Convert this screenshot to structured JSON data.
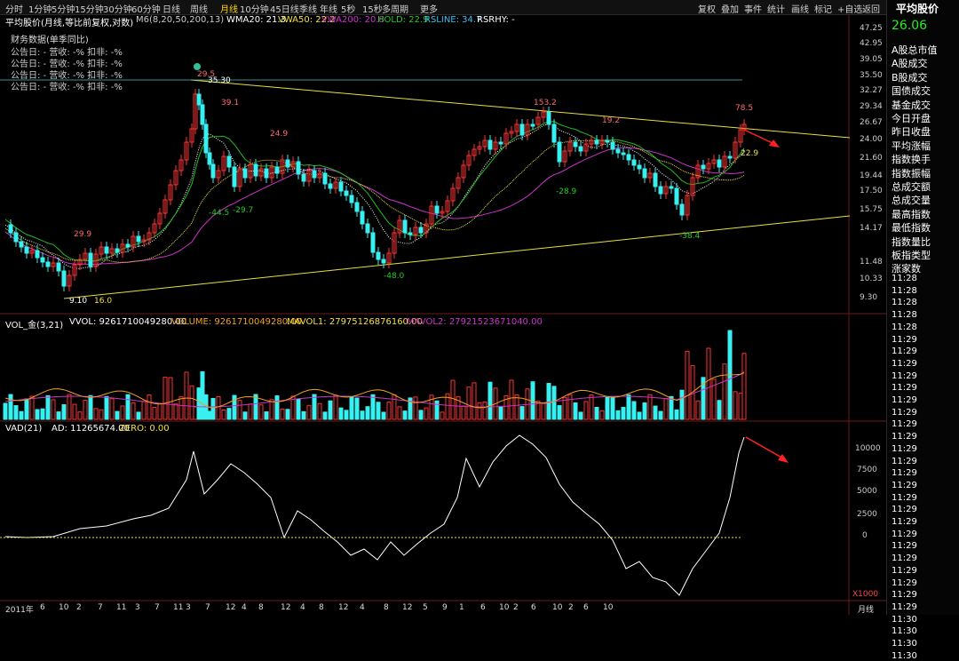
{
  "toolbar": {
    "timeframes": [
      "分时",
      "1分钟",
      "5分钟",
      "15分钟",
      "30分钟",
      "60分钟",
      "日线",
      "周线",
      "月线",
      "10分钟",
      "45日线",
      "季线",
      "年线",
      "5秒",
      "15秒",
      "多周期",
      "更多"
    ],
    "active": "月线",
    "right_buttons": [
      "复权",
      "叠加",
      "事件",
      "统计",
      "画线",
      "标记",
      "+自选",
      "返回"
    ]
  },
  "main_header": {
    "title": "平均股价(月线,等比前复权,对数)",
    "m6": "M6(8,20,50,200,13)",
    "wma20": "WMA20: 21.3",
    "vwa50": "VWA50: 22.2",
    "vwa200": "VWA200: 20.8",
    "hold": "HOLD: 22.9",
    "rsline": "RSLINE: 34.7",
    "rsrhy": "RSRHY: -"
  },
  "finance": {
    "title": "财务数据(单季同比)",
    "rows": [
      "公告日: -  营收: -%  扣非: -%",
      "公告日: -  营收: -%  扣非: -%",
      "公告日: -  营收: -%  扣非: -%",
      "公告日: -  营收: -%  扣非: -%"
    ]
  },
  "price_axis": [
    "47.25",
    "42.95",
    "39.05",
    "35.50",
    "32.27",
    "29.34",
    "26.67",
    "24.00",
    "21.60",
    "19.44",
    "17.50",
    "15.75",
    "14.17",
    "11.48",
    "10.33",
    "9.30"
  ],
  "price_labels": {
    "p1": "29.9",
    "p2": "9.10",
    "p3": "16.0",
    "p4": "29.5",
    "p5": "35.30",
    "p6": "39.1",
    "p7": "-44.5",
    "p8": "-29.7",
    "p9": "24.9",
    "p10": "-48.0",
    "p11": "153.2",
    "p12": "19.2",
    "p13": "-28.9",
    "p14": "-38.4",
    "p15": "78.5",
    "p16": "22.9"
  },
  "vol_header": {
    "name": "VOL_金(3,21)",
    "vvol": "VVOL: 9261710049280.00",
    "volume": "VOLUME: 9261710049280.00",
    "mavol1": "MAVOL1: 27975126876160.00",
    "mavol2": "MAVOL2: 27921523671040.00"
  },
  "vad_header": {
    "name": "VAD(21)",
    "ad": "AD: 11265674.00",
    "zero": "ZERO: 0.00"
  },
  "vad_axis": [
    "10000",
    "7500",
    "5000",
    "2500",
    "0"
  ],
  "vad_unit": "X1000",
  "date_axis": [
    "2011年",
    "6",
    "10",
    "2",
    "7",
    "11",
    "3",
    "7",
    "11",
    "3",
    "7",
    "12",
    "4",
    "8",
    "12",
    "4",
    "8",
    "12",
    "4",
    "8",
    "12",
    "5",
    "9",
    "1",
    "6",
    "10",
    "2",
    "6",
    "10",
    "2",
    "6",
    "10"
  ],
  "date_unit": "月线",
  "right_panel": {
    "title": "平均股价",
    "price": "26.06",
    "items": [
      "A股总市值",
      "A股成交",
      "B股成交",
      "国债成交",
      "基金成交",
      "今日开盘",
      "昨日收盘",
      "平均涨幅",
      "指数换手",
      "指数振幅",
      "总成交额",
      "总成交量",
      "最高指数",
      "最低指数",
      "指数量比",
      "板指类型",
      "涨家数"
    ],
    "times": [
      "11:28",
      "11:28",
      "11:28",
      "11:28",
      "11:28",
      "11:29",
      "11:29",
      "11:29",
      "11:29",
      "11:29",
      "11:29",
      "11:29",
      "11:29",
      "11:29",
      "11:29",
      "11:29",
      "11:29",
      "11:29",
      "11:29",
      "11:29",
      "11:29",
      "11:29",
      "11:29",
      "11:29",
      "11:29",
      "11:29",
      "11:29",
      "11:29",
      "11:30",
      "11:30",
      "11:30",
      "11:30"
    ]
  },
  "colors": {
    "up": "#ff3333",
    "down": "#38f0f0",
    "ma_white": "#ffffff",
    "ma_yellow": "#f0e040",
    "ma_purple": "#cc33cc",
    "ma_green": "#22bb22",
    "arrow": "#ff2222"
  }
}
